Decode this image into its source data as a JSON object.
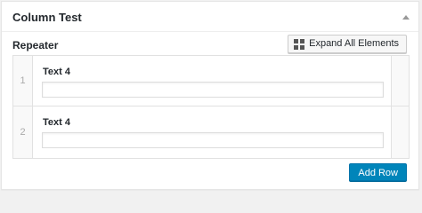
{
  "box": {
    "title": "Column Test"
  },
  "field": {
    "label": "Repeater",
    "expand_label": "Expand All Elements",
    "add_row_label": "Add Row"
  },
  "rows": [
    {
      "index": "1",
      "sub_label": "Text 4",
      "value": ""
    },
    {
      "index": "2",
      "sub_label": "Text 4",
      "value": ""
    }
  ],
  "colors": {
    "primary_button": "#0085ba",
    "border": "#e1e1e1",
    "handle_bg": "#f9f9f9"
  }
}
